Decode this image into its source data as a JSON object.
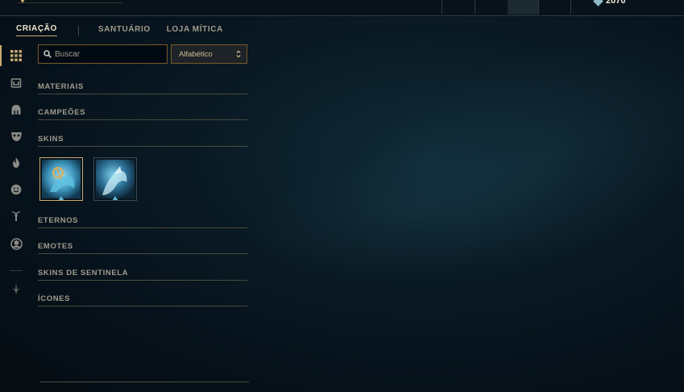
{
  "topbar": {
    "currency_value": "2070",
    "currency_icon": "rp-icon"
  },
  "tabs": [
    {
      "label": "CRIAÇÃO",
      "active": true
    },
    {
      "label": "SANTUÁRIO",
      "active": false
    },
    {
      "label": "LOJA MÍTICA",
      "active": false
    }
  ],
  "sidebar": {
    "icons": [
      "grid-icon",
      "chest-icon",
      "helmet-icon",
      "mask-icon",
      "flame-icon",
      "emote-icon",
      "ward-icon",
      "profile-icon",
      "sword-icon"
    ]
  },
  "search": {
    "placeholder": "Buscar",
    "value": ""
  },
  "sort": {
    "selected": "Alfabético"
  },
  "sections": [
    {
      "label": "MATERIAIS"
    },
    {
      "label": "CAMPEÕES"
    },
    {
      "label": "SKINS"
    },
    {
      "label": "ETERNOS"
    },
    {
      "label": "EMOTES"
    },
    {
      "label": "SKINS DE SENTINELA"
    },
    {
      "label": "ÍCONES"
    }
  ],
  "skins": [
    {
      "name": "skin-tile-1",
      "selected": true
    },
    {
      "name": "skin-tile-2",
      "selected": false
    }
  ],
  "colors": {
    "gold": "#c8aa6e",
    "gold_dark": "#785a28",
    "text": "#a09b8c",
    "bg": "#0a1a24"
  }
}
